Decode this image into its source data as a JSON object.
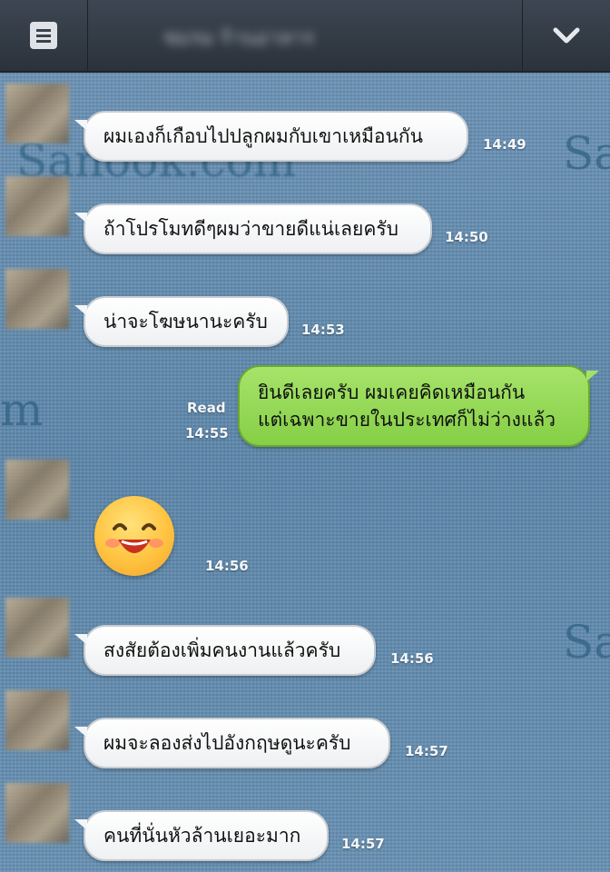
{
  "header": {
    "title": "ชมรม ร้านอาหาร",
    "menu_icon": "menu-icon",
    "collapse_icon": "chevron-down-icon"
  },
  "watermarks": [
    "Sanook.com",
    "Sa",
    "m",
    "Sa"
  ],
  "messages": [
    {
      "from": "other",
      "text": "ผมเองก็เกือบไปปลูกผมกับเขาเหมือนกัน",
      "time": "14:49"
    },
    {
      "from": "other",
      "text": "ถ้าโปรโมทดีๆผมว่าขายดีแน่เลยครับ",
      "time": "14:50"
    },
    {
      "from": "other",
      "text": "น่าจะโฆษนานะครับ",
      "time": "14:53"
    },
    {
      "from": "me",
      "lines": [
        "ยินดีเลยครับ ผมเคยคิดเหมือนกัน",
        "แต่เฉพาะขายในประเทศก็ไม่ว่างแล้ว"
      ],
      "status": "Read",
      "time": "14:55"
    },
    {
      "from": "other",
      "sticker": "smiling-face-sticker",
      "time": "14:56"
    },
    {
      "from": "other",
      "text": "สงสัยต้องเพิ่มคนงานแล้วครับ",
      "time": "14:56"
    },
    {
      "from": "other",
      "text": "ผมจะลองส่งไปอังกฤษดูนะครับ",
      "time": "14:57"
    },
    {
      "from": "other",
      "text": "คนที่นั่นหัวล้านเยอะมาก",
      "time": "14:57"
    }
  ],
  "colors": {
    "topbar": "#2f3640",
    "my_bubble": "#93d856",
    "other_bubble": "#ffffff",
    "background": "#5f88ab"
  }
}
